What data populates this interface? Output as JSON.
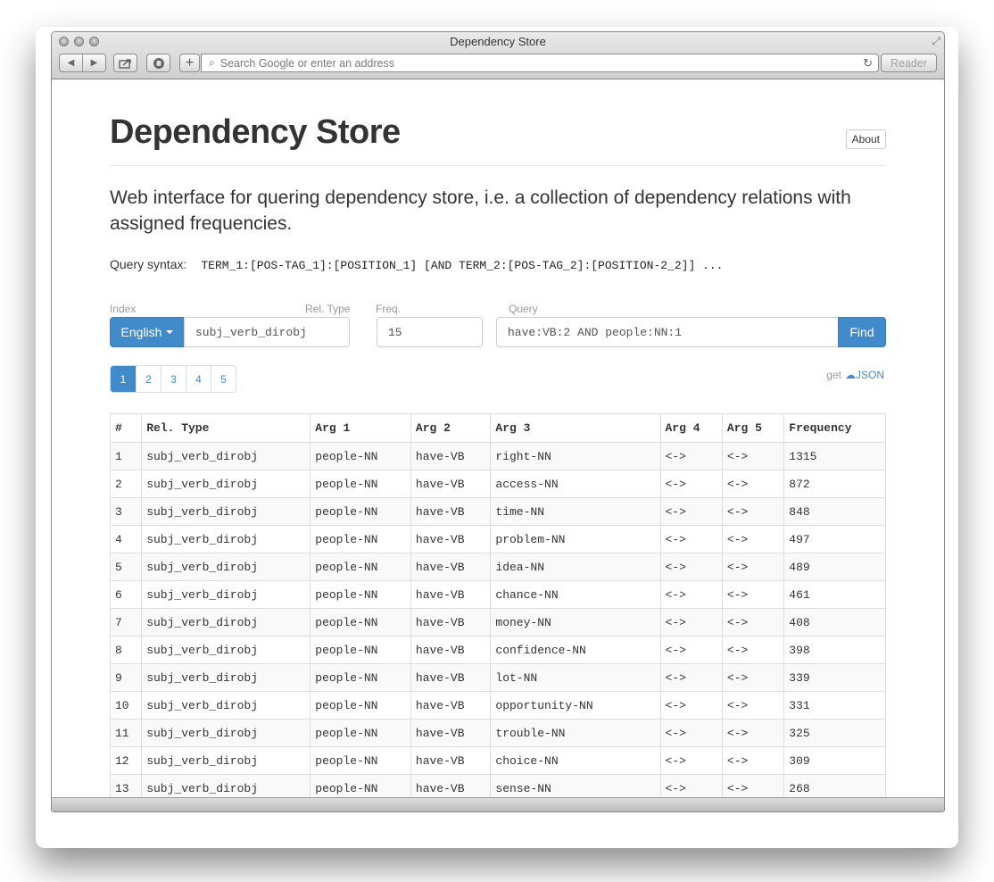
{
  "window": {
    "title": "Dependency Store"
  },
  "toolbar": {
    "address_placeholder": "Search Google or enter an address",
    "reader_label": "Reader",
    "back_glyph": "◀",
    "forward_glyph": "▶",
    "add_glyph": "+"
  },
  "page": {
    "heading": "Dependency Store",
    "about_label": "About",
    "lead": "Web interface for quering dependency store, i.e. a collection of dependency relations with assigned frequencies.",
    "syntax_label": "Query syntax:",
    "syntax_code": "TERM_1:[POS-TAG_1]:[POSITION_1] [AND TERM_2:[POS-TAG_2]:[POSITION-2_2]] ..."
  },
  "form": {
    "index_label": "Index",
    "reltype_label": "Rel. Type",
    "freq_label": "Freq.",
    "query_label": "Query",
    "index_value": "English",
    "reltype_value": "subj_verb_dirobj",
    "freq_value": "15",
    "query_value": "have:VB:2 AND people:NN:1",
    "find_label": "Find"
  },
  "pagination": {
    "pages": [
      "1",
      "2",
      "3",
      "4",
      "5"
    ],
    "active": "1"
  },
  "json_link": {
    "prefix": "get",
    "label": "JSON"
  },
  "table": {
    "headers": [
      "#",
      "Rel. Type",
      "Arg 1",
      "Arg 2",
      "Arg 3",
      "Arg 4",
      "Arg 5",
      "Frequency"
    ],
    "rows": [
      [
        "1",
        "subj_verb_dirobj",
        "people-NN",
        "have-VB",
        "right-NN",
        "<->",
        "<->",
        "1315"
      ],
      [
        "2",
        "subj_verb_dirobj",
        "people-NN",
        "have-VB",
        "access-NN",
        "<->",
        "<->",
        "872"
      ],
      [
        "3",
        "subj_verb_dirobj",
        "people-NN",
        "have-VB",
        "time-NN",
        "<->",
        "<->",
        "848"
      ],
      [
        "4",
        "subj_verb_dirobj",
        "people-NN",
        "have-VB",
        "problem-NN",
        "<->",
        "<->",
        "497"
      ],
      [
        "5",
        "subj_verb_dirobj",
        "people-NN",
        "have-VB",
        "idea-NN",
        "<->",
        "<->",
        "489"
      ],
      [
        "6",
        "subj_verb_dirobj",
        "people-NN",
        "have-VB",
        "chance-NN",
        "<->",
        "<->",
        "461"
      ],
      [
        "7",
        "subj_verb_dirobj",
        "people-NN",
        "have-VB",
        "money-NN",
        "<->",
        "<->",
        "408"
      ],
      [
        "8",
        "subj_verb_dirobj",
        "people-NN",
        "have-VB",
        "confidence-NN",
        "<->",
        "<->",
        "398"
      ],
      [
        "9",
        "subj_verb_dirobj",
        "people-NN",
        "have-VB",
        "lot-NN",
        "<->",
        "<->",
        "339"
      ],
      [
        "10",
        "subj_verb_dirobj",
        "people-NN",
        "have-VB",
        "opportunity-NN",
        "<->",
        "<->",
        "331"
      ],
      [
        "11",
        "subj_verb_dirobj",
        "people-NN",
        "have-VB",
        "trouble-NN",
        "<->",
        "<->",
        "325"
      ],
      [
        "12",
        "subj_verb_dirobj",
        "people-NN",
        "have-VB",
        "choice-NN",
        "<->",
        "<->",
        "309"
      ],
      [
        "13",
        "subj_verb_dirobj",
        "people-NN",
        "have-VB",
        "sense-NN",
        "<->",
        "<->",
        "268"
      ]
    ]
  },
  "colors": {
    "primary": "#428bca",
    "text": "#333333",
    "border": "#dddddd"
  }
}
